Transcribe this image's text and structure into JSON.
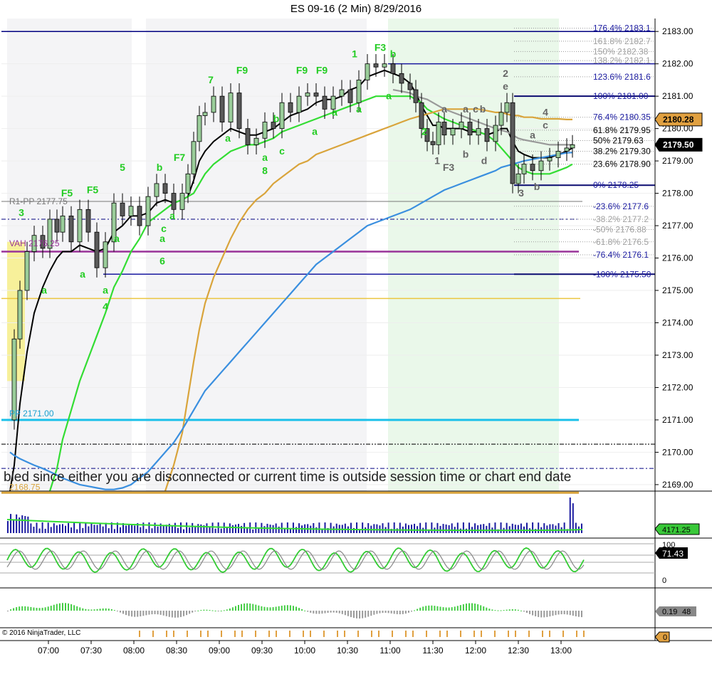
{
  "title": "ES 09-16 (2 Min)  8/29/2016",
  "copyright": "© 2016 NinjaTrader, LLC",
  "status_message": "bled since either you are disconnected or current time is outside session time or chart end date",
  "colors": {
    "up_candle": "#9acd9a",
    "ema_fast": "#000000",
    "ema_green": "#33dd33",
    "ema_gold": "#d9a43b",
    "ema_blue": "#3a8fdf",
    "ema_gray": "#999999",
    "price_tag_gold": "#e0a040",
    "price_tag_black": "#000000",
    "volume_tag": "#39c839",
    "navy": "#000080",
    "fib_blue": "#1a1aa0"
  },
  "chart_data": {
    "type": "line",
    "instrument": "ES 09-16",
    "interval": "2 Min",
    "date": "8/29/2016",
    "ylim": [
      2168.8,
      2183.4
    ],
    "y_ticks": [
      "2169.00",
      "2170.00",
      "2171.00",
      "2172.00",
      "2173.00",
      "2174.00",
      "2175.00",
      "2176.00",
      "2177.00",
      "2178.00",
      "2179.00",
      "2180.00",
      "2181.00",
      "2182.00",
      "2183.00"
    ],
    "x_ticks": [
      "07:00",
      "07:30",
      "08:00",
      "08:30",
      "09:00",
      "09:30",
      "10:00",
      "10:30",
      "11:00",
      "11:30",
      "12:00",
      "12:30",
      "13:00"
    ],
    "price": {
      "x": [
        "06:33",
        "06:36",
        "06:40",
        "06:45",
        "06:50",
        "06:56",
        "07:01",
        "07:06",
        "07:10",
        "07:16",
        "07:22",
        "07:28",
        "07:34",
        "07:40",
        "07:46",
        "07:52",
        "07:58",
        "08:04",
        "08:10",
        "08:16",
        "08:22",
        "08:28",
        "08:34",
        "08:38",
        "08:42",
        "08:46",
        "08:50",
        "08:56",
        "09:02",
        "09:08",
        "09:14",
        "09:20",
        "09:26",
        "09:32",
        "09:38",
        "09:44",
        "09:50",
        "09:56",
        "10:02",
        "10:08",
        "10:14",
        "10:20",
        "10:26",
        "10:32",
        "10:38",
        "10:44",
        "10:50",
        "10:56",
        "11:02",
        "11:08",
        "11:14",
        "11:18",
        "11:22",
        "11:26",
        "11:30",
        "11:34",
        "11:38",
        "11:44",
        "11:50",
        "11:56",
        "12:02",
        "12:08",
        "12:14",
        "12:18",
        "12:22",
        "12:26",
        "12:30",
        "12:34",
        "12:40",
        "12:46",
        "12:52",
        "12:58",
        "13:04",
        "13:08"
      ],
      "y": [
        2171.0,
        2173.5,
        2175.0,
        2176.2,
        2176.7,
        2176.3,
        2177.2,
        2176.8,
        2177.3,
        2176.5,
        2177.5,
        2176.8,
        2175.7,
        2176.5,
        2177.7,
        2177.3,
        2177.6,
        2177.0,
        2177.9,
        2178.3,
        2178.0,
        2177.5,
        2178.0,
        2178.6,
        2179.6,
        2180.4,
        2180.5,
        2181.0,
        2180.2,
        2181.1,
        2180.0,
        2179.5,
        2179.7,
        2180.2,
        2180.0,
        2180.8,
        2180.5,
        2181.0,
        2181.1,
        2181.0,
        2180.6,
        2181.0,
        2181.2,
        2180.8,
        2181.5,
        2182.0,
        2181.9,
        2182.0,
        2181.7,
        2181.4,
        2181.2,
        2180.8,
        2180.0,
        2179.6,
        2179.5,
        2180.2,
        2179.8,
        2180.0,
        2180.2,
        2179.8,
        2180.0,
        2179.6,
        2180.1,
        2180.5,
        2180.8,
        2178.3,
        2178.6,
        2178.9,
        2178.7,
        2179.0,
        2179.1,
        2179.3,
        2179.4,
        2179.5
      ]
    },
    "moving_averages": [
      {
        "color": "ema_fast",
        "y": [
          2168.8,
          2169.6,
          2171.5,
          2173.1,
          2174.3,
          2175.1,
          2175.6,
          2176.0,
          2176.2,
          2176.2,
          2176.4,
          2176.3,
          2176.2,
          2176.3,
          2176.8,
          2177.0,
          2177.3,
          2177.3,
          2177.4,
          2177.7,
          2177.8,
          2177.7,
          2177.8,
          2177.9,
          2178.4,
          2179.0,
          2179.3,
          2179.6,
          2179.8,
          2180.0,
          2179.9,
          2179.8,
          2179.8,
          2179.9,
          2180.0,
          2180.2,
          2180.4,
          2180.5,
          2180.6,
          2180.8,
          2180.9,
          2180.9,
          2181.0,
          2181.2,
          2181.3,
          2181.6,
          2181.7,
          2181.8,
          2181.7,
          2181.6,
          2181.4,
          2181.1,
          2180.7,
          2180.4,
          2180.1,
          2180.1,
          2180.0,
          2180.0,
          2180.0,
          2179.9,
          2179.9,
          2179.8,
          2179.9,
          2180.0,
          2180.0,
          2179.6,
          2179.3,
          2179.2,
          2179.1,
          2179.1,
          2179.1,
          2179.2,
          2179.3,
          2179.4
        ]
      },
      {
        "color": "ema_green",
        "y": [
          null,
          null,
          null,
          null,
          null,
          null,
          2168.8,
          2169.5,
          2170.4,
          2171.3,
          2172.2,
          2172.9,
          2173.6,
          2174.3,
          2175.1,
          2175.6,
          2176.2,
          2176.6,
          2177.1,
          2177.3,
          2177.5,
          2177.7,
          2177.8,
          2177.9,
          2178.0,
          2178.3,
          2178.6,
          2178.9,
          2179.1,
          2179.3,
          2179.4,
          2179.5,
          2179.5,
          2179.6,
          2179.7,
          2179.9,
          2180.0,
          2180.1,
          2180.2,
          2180.3,
          2180.4,
          2180.5,
          2180.6,
          2180.7,
          2180.8,
          2180.9,
          2181.0,
          2181.0,
          2181.0,
          2181.0,
          2181.0,
          2180.9,
          2180.8,
          2180.6,
          2180.5,
          2180.4,
          2180.3,
          2180.2,
          2180.1,
          2180.0,
          2179.9,
          2179.8,
          2179.6,
          2179.4,
          2179.2,
          2179.0,
          2178.8,
          2178.7,
          2178.6,
          2178.6,
          2178.6,
          2178.7,
          2178.8,
          2178.9
        ]
      },
      {
        "color": "ema_gold",
        "y": [
          null,
          null,
          null,
          null,
          null,
          null,
          null,
          null,
          null,
          null,
          null,
          null,
          null,
          null,
          null,
          null,
          null,
          null,
          null,
          null,
          2168.8,
          2169.6,
          2170.6,
          2171.7,
          2172.8,
          2173.8,
          2174.6,
          2175.4,
          2176.0,
          2176.6,
          2177.1,
          2177.5,
          2177.8,
          2178.0,
          2178.3,
          2178.5,
          2178.7,
          2178.9,
          2179.0,
          2179.2,
          2179.3,
          2179.4,
          2179.5,
          2179.6,
          2179.7,
          2179.8,
          2179.9,
          2180.0,
          2180.1,
          2180.2,
          2180.3,
          2180.35,
          2180.4,
          2180.45,
          2180.5,
          2180.55,
          2180.6,
          2180.6,
          2180.6,
          2180.6,
          2180.6,
          2180.55,
          2180.5,
          2180.5,
          2180.45,
          2180.4,
          2180.4,
          2180.35,
          2180.35,
          2180.3,
          2180.3,
          2180.3,
          2180.28,
          2180.28
        ]
      },
      {
        "color": "ema_blue",
        "y": [
          2170.0,
          2169.9,
          2169.8,
          2169.7,
          2169.6,
          2169.5,
          2169.4,
          2169.3,
          2169.2,
          2169.1,
          2169.0,
          2168.95,
          2168.9,
          2168.85,
          2168.85,
          2168.9,
          2169.0,
          2169.2,
          2169.4,
          2169.7,
          2170.0,
          2170.3,
          2170.7,
          2171.0,
          2171.3,
          2171.6,
          2171.9,
          2172.2,
          2172.5,
          2172.8,
          2173.1,
          2173.4,
          2173.7,
          2174.0,
          2174.3,
          2174.6,
          2174.9,
          2175.2,
          2175.5,
          2175.8,
          2176.0,
          2176.2,
          2176.4,
          2176.6,
          2176.8,
          2177.0,
          2177.1,
          2177.2,
          2177.3,
          2177.4,
          2177.5,
          2177.6,
          2177.7,
          2177.8,
          2177.9,
          2178.0,
          2178.1,
          2178.2,
          2178.3,
          2178.4,
          2178.5,
          2178.6,
          2178.7,
          2178.8,
          2178.85,
          2178.9,
          2178.95,
          2179.0,
          2179.05,
          2179.1,
          2179.15,
          2179.2,
          2179.25,
          2179.26
        ]
      },
      {
        "color": "ema_gray",
        "y": [
          null,
          null,
          null,
          null,
          null,
          null,
          null,
          null,
          null,
          null,
          null,
          null,
          null,
          null,
          null,
          null,
          null,
          null,
          null,
          null,
          null,
          null,
          null,
          null,
          null,
          null,
          null,
          null,
          null,
          null,
          null,
          null,
          null,
          null,
          null,
          null,
          null,
          null,
          null,
          null,
          null,
          null,
          null,
          null,
          null,
          null,
          null,
          null,
          2181.2,
          2181.15,
          2181.1,
          2181.0,
          2180.95,
          2180.9,
          2180.8,
          2180.7,
          2180.6,
          2180.5,
          2180.4,
          2180.3,
          2180.2,
          2180.1,
          2180.0,
          2179.95,
          2179.9,
          2179.8,
          2179.7,
          2179.65,
          2179.6,
          2179.55,
          2179.5,
          2179.5,
          2179.5,
          2179.5
        ]
      }
    ],
    "fib_levels": [
      {
        "label": "176.4%",
        "value": "2183.1"
      },
      {
        "label": "161.8%",
        "value": "2182.7"
      },
      {
        "label": "150%",
        "value": "2182.38"
      },
      {
        "label": "138.2%",
        "value": "2182.1"
      },
      {
        "label": "123.6%",
        "value": "2181.6"
      },
      {
        "label": "100%",
        "value": "2181.00"
      },
      {
        "label": "76.4%",
        "value": "2180.35"
      },
      {
        "label": "61.8%",
        "value": "2179.95"
      },
      {
        "label": "50%",
        "value": "2179.63"
      },
      {
        "label": "38.2%",
        "value": "2179.30"
      },
      {
        "label": "23.6%",
        "value": "2178.90"
      },
      {
        "label": "0%",
        "value": "2178.25"
      },
      {
        "label": "-23.6%",
        "value": "2177.6"
      },
      {
        "label": "-38.2%",
        "value": "2177.2"
      },
      {
        "label": "-50%",
        "value": "2176.88"
      },
      {
        "label": "-61.8%",
        "value": "2176.5"
      },
      {
        "label": "-76.4%",
        "value": "2176.1"
      },
      {
        "label": "-100%",
        "value": "2175.50"
      }
    ],
    "pivot_labels": [
      {
        "text": "R1-PP 2177.75",
        "value": 2177.75
      },
      {
        "text": "VAH 2176.25",
        "value": 2176.25
      },
      {
        "text": "PP 2171.00",
        "value": 2171.0
      },
      {
        "text": "2168.75",
        "value": 2168.75
      }
    ],
    "price_tags": [
      {
        "value": 2180.28,
        "text": "2180.28",
        "color": "price_tag_gold"
      },
      {
        "value": 2179.5,
        "text": "2179.50",
        "color": "price_tag_black"
      }
    ],
    "wave_labels": [
      {
        "t": "3",
        "x": "06:41",
        "y": 2177.3,
        "c": "g"
      },
      {
        "t": "F5",
        "x": "07:13",
        "y": 2177.9,
        "c": "g"
      },
      {
        "t": "F5",
        "x": "07:31",
        "y": 2178.0,
        "c": "g"
      },
      {
        "t": "5",
        "x": "07:52",
        "y": 2178.7,
        "c": "g"
      },
      {
        "t": "b",
        "x": "08:18",
        "y": 2178.7,
        "c": "g"
      },
      {
        "t": "F7",
        "x": "08:32",
        "y": 2179.0,
        "c": "g"
      },
      {
        "t": "7",
        "x": "08:54",
        "y": 2181.4,
        "c": "g"
      },
      {
        "t": "F9",
        "x": "09:16",
        "y": 2181.7,
        "c": "g"
      },
      {
        "t": "F9",
        "x": "09:58",
        "y": 2181.7,
        "c": "g"
      },
      {
        "t": "F9",
        "x": "10:12",
        "y": 2181.7,
        "c": "g"
      },
      {
        "t": "1",
        "x": "10:35",
        "y": 2182.2,
        "c": "g"
      },
      {
        "t": "F3",
        "x": "10:53",
        "y": 2182.4,
        "c": "g"
      },
      {
        "t": "b",
        "x": "11:02",
        "y": 2182.2,
        "c": "g"
      },
      {
        "t": "a",
        "x": "06:57",
        "y": 2174.9,
        "c": "g"
      },
      {
        "t": "a",
        "x": "07:24",
        "y": 2175.4,
        "c": "g"
      },
      {
        "t": "a",
        "x": "07:40",
        "y": 2174.9,
        "c": "g"
      },
      {
        "t": "4",
        "x": "07:40",
        "y": 2174.4,
        "c": "g"
      },
      {
        "t": "a",
        "x": "07:48",
        "y": 2176.5,
        "c": "g"
      },
      {
        "t": "a",
        "x": "08:20",
        "y": 2176.5,
        "c": "g"
      },
      {
        "t": "c",
        "x": "08:21",
        "y": 2176.8,
        "c": "g"
      },
      {
        "t": "6",
        "x": "08:20",
        "y": 2175.8,
        "c": "g"
      },
      {
        "t": "a",
        "x": "08:27",
        "y": 2177.2,
        "c": "g"
      },
      {
        "t": "a",
        "x": "09:06",
        "y": 2179.6,
        "c": "g"
      },
      {
        "t": "b",
        "x": "09:40",
        "y": 2180.2,
        "c": "g"
      },
      {
        "t": "a",
        "x": "09:32",
        "y": 2179.0,
        "c": "g"
      },
      {
        "t": "8",
        "x": "09:32",
        "y": 2178.6,
        "c": "g"
      },
      {
        "t": "c",
        "x": "09:44",
        "y": 2179.2,
        "c": "g"
      },
      {
        "t": "a",
        "x": "10:07",
        "y": 2179.8,
        "c": "g"
      },
      {
        "t": "a",
        "x": "10:21",
        "y": 2180.4,
        "c": "g"
      },
      {
        "t": "a",
        "x": "10:38",
        "y": 2180.5,
        "c": "g"
      },
      {
        "t": "a",
        "x": "10:59",
        "y": 2180.9,
        "c": "g"
      },
      {
        "t": "2",
        "x": "11:24",
        "y": 2179.8,
        "c": "g"
      },
      {
        "t": "2",
        "x": "12:21",
        "y": 2181.6,
        "c": "k"
      },
      {
        "t": "e",
        "x": "12:21",
        "y": 2181.2,
        "c": "k"
      },
      {
        "t": "a",
        "x": "11:38",
        "y": 2180.5,
        "c": "k"
      },
      {
        "t": "a",
        "x": "11:53",
        "y": 2180.5,
        "c": "k"
      },
      {
        "t": "c",
        "x": "12:00",
        "y": 2180.5,
        "c": "k"
      },
      {
        "t": "b",
        "x": "12:05",
        "y": 2180.5,
        "c": "k"
      },
      {
        "t": "1",
        "x": "11:33",
        "y": 2178.9,
        "c": "k"
      },
      {
        "t": "F3",
        "x": "11:41",
        "y": 2178.7,
        "c": "k"
      },
      {
        "t": "b",
        "x": "11:53",
        "y": 2179.1,
        "c": "k"
      },
      {
        "t": "d",
        "x": "12:06",
        "y": 2178.9,
        "c": "k"
      },
      {
        "t": "4",
        "x": "12:49",
        "y": 2180.4,
        "c": "k"
      },
      {
        "t": "c",
        "x": "12:49",
        "y": 2180.0,
        "c": "k"
      },
      {
        "t": "a",
        "x": "12:40",
        "y": 2179.7,
        "c": "k"
      },
      {
        "t": "3",
        "x": "12:32",
        "y": 2177.9,
        "c": "k"
      },
      {
        "t": "b",
        "x": "12:43",
        "y": 2178.1,
        "c": "k"
      }
    ],
    "volume_tag": "4171.25",
    "stochastic_ticks": [
      "100",
      "0"
    ],
    "stochastic_tag": "71.43",
    "momentum_tags": [
      "0.19",
      "48"
    ],
    "bottom_tag": "0"
  }
}
